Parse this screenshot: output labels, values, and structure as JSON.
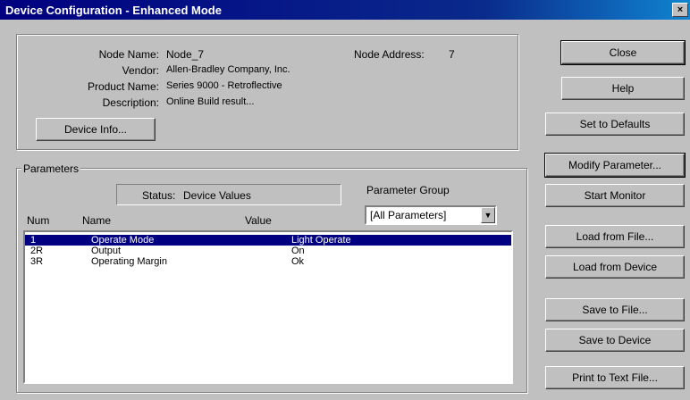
{
  "window": {
    "title": "Device Configuration - Enhanced Mode",
    "close_glyph": "×"
  },
  "device": {
    "node_name_label": "Node Name:",
    "node_name": "Node_7",
    "node_address_label": "Node Address:",
    "node_address": "7",
    "vendor_label": "Vendor:",
    "vendor": "Allen-Bradley Company, Inc.",
    "product_label": "Product Name:",
    "product": "Series 9000 - Retroflective",
    "description_label": "Description:",
    "description": "Online Build result...",
    "info_button": "Device Info..."
  },
  "parameters": {
    "group_label": "Parameters",
    "status_label": "Status:",
    "status_value": "Device Values",
    "param_group_label": "Parameter Group",
    "param_group_value": "[All Parameters]",
    "columns": {
      "num": "Num",
      "name": "Name",
      "value": "Value"
    },
    "rows": [
      {
        "num": "1",
        "name": "Operate Mode",
        "value": "Light Operate"
      },
      {
        "num": "2R",
        "name": "Output",
        "value": "On"
      },
      {
        "num": "3R",
        "name": "Operating Margin",
        "value": "Ok"
      }
    ]
  },
  "buttons": {
    "close": "Close",
    "help": "Help",
    "set_defaults": "Set to Defaults",
    "modify": "Modify Parameter...",
    "start_monitor": "Start Monitor",
    "load_file": "Load from File...",
    "load_device": "Load from Device",
    "save_file": "Save to File...",
    "save_device": "Save to Device",
    "print": "Print to Text File..."
  }
}
